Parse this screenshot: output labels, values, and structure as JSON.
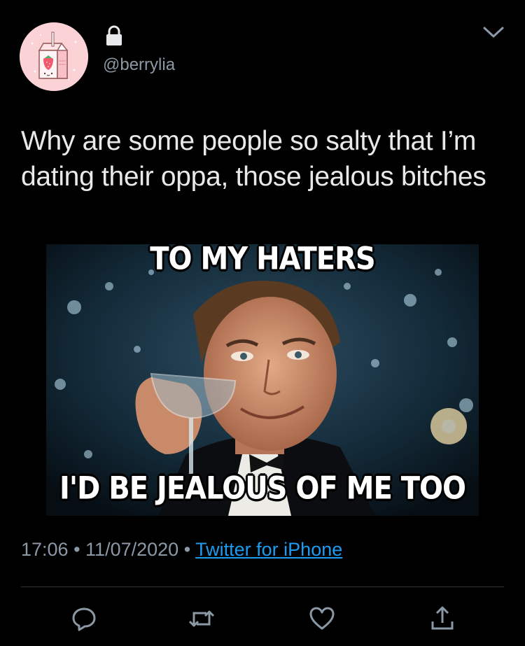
{
  "user": {
    "handle": "@berrylia",
    "avatar_icon": "strawberry-milk-carton-icon",
    "locked": true
  },
  "tweet": {
    "text": "Why are some people so salty that I’m dating their oppa, those jealous bitches"
  },
  "media": {
    "top_caption": "TO MY HATERS",
    "bottom_caption": "I'D BE JEALOUS OF ME TOO"
  },
  "meta": {
    "time": "17:06",
    "sep1": " • ",
    "date": "11/07/2020",
    "sep2": " • ",
    "source": "Twitter for iPhone"
  },
  "actions": {
    "icons": [
      "reply-icon",
      "retweet-icon",
      "like-icon",
      "share-icon"
    ]
  },
  "colors": {
    "background": "#000000",
    "text": "#e7e9ea",
    "secondary": "#8b98a5",
    "link": "#1d9bf0"
  }
}
